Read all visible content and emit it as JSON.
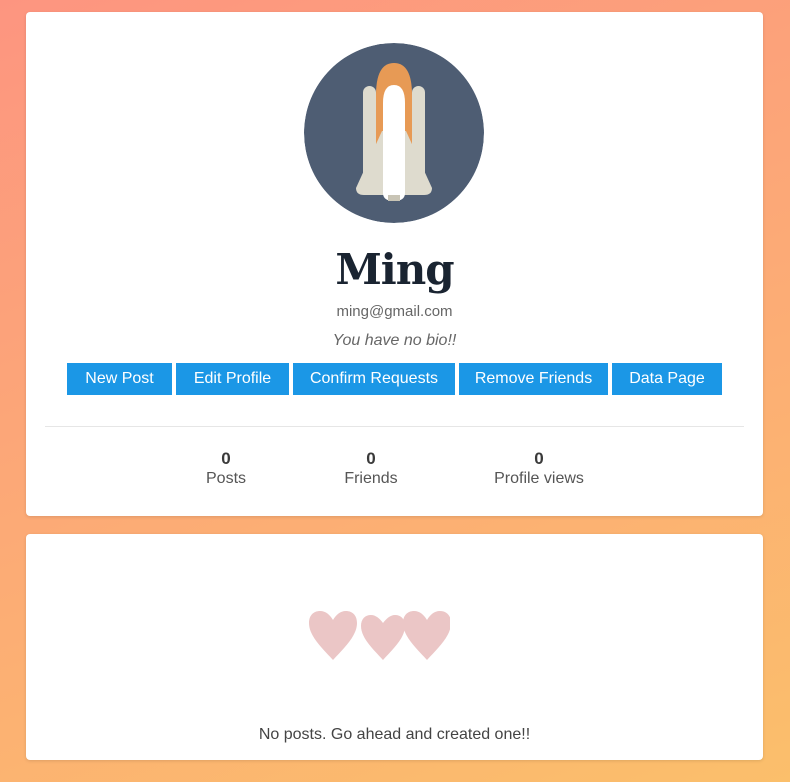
{
  "profile": {
    "username": "Ming",
    "email": "ming@gmail.com",
    "bio": "You have no bio!!",
    "avatar_icon": "space-shuttle-icon",
    "buttons": {
      "new_post": "New Post",
      "edit_profile": "Edit Profile",
      "confirm_requests": "Confirm Requests",
      "remove_friends": "Remove Friends",
      "data_page": "Data Page"
    },
    "stats": [
      {
        "count": "0",
        "label": "Posts"
      },
      {
        "count": "0",
        "label": "Friends"
      },
      {
        "count": "0",
        "label": "Profile views"
      }
    ]
  },
  "posts": {
    "empty_icon": "hearts-icon",
    "empty_message": "No posts. Go ahead and created one!!"
  },
  "colors": {
    "button": "#1b97e6",
    "avatar_bg": "#4e5d73",
    "heart": "#ebc6c6"
  }
}
